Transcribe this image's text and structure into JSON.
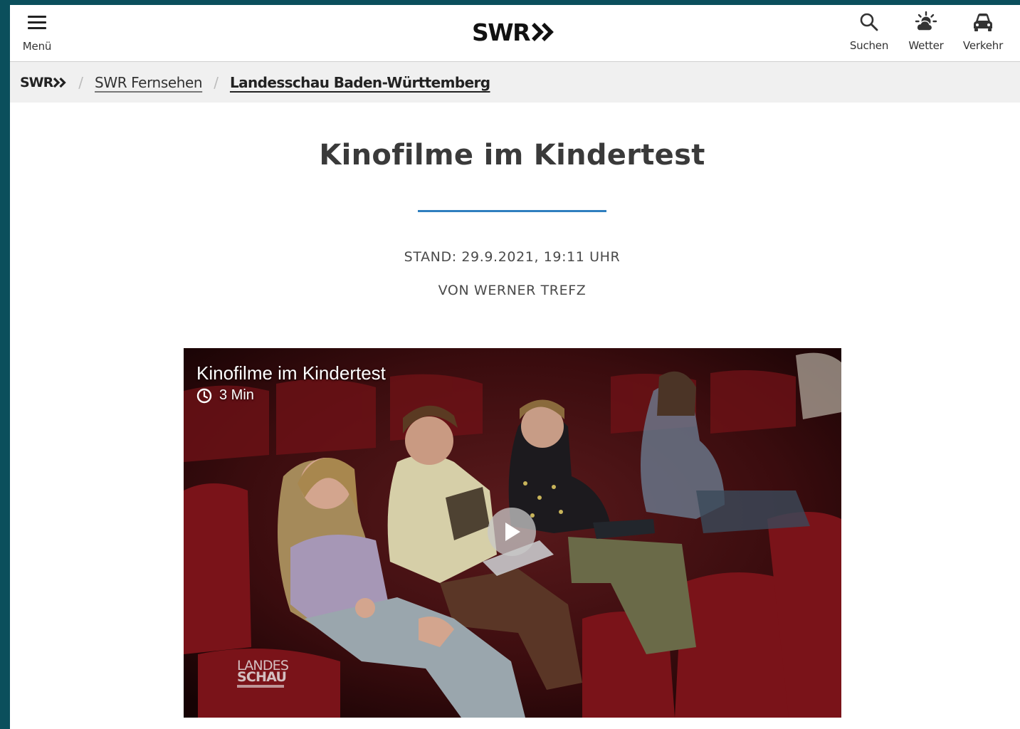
{
  "header": {
    "menu_label": "Menü",
    "logo_text": "SWR",
    "actions": [
      {
        "label": "Suchen",
        "icon": "search-icon"
      },
      {
        "label": "Wetter",
        "icon": "weather-icon"
      },
      {
        "label": "Verkehr",
        "icon": "car-icon"
      }
    ]
  },
  "breadcrumb": {
    "home_text": "SWR",
    "items": [
      {
        "label": "SWR Fernsehen"
      },
      {
        "label": "Landesschau Baden-Württemberg"
      }
    ]
  },
  "article": {
    "title": "Kinofilme im Kindertest",
    "date": "STAND: 29.9.2021, 19:11 UHR",
    "author": "VON WERNER TREFZ",
    "accent_color": "#2f7fbf"
  },
  "video": {
    "title": "Kinofilme im Kindertest",
    "duration": "3 Min",
    "brand_line1": "LANDES",
    "brand_line2": "SCHAU"
  }
}
